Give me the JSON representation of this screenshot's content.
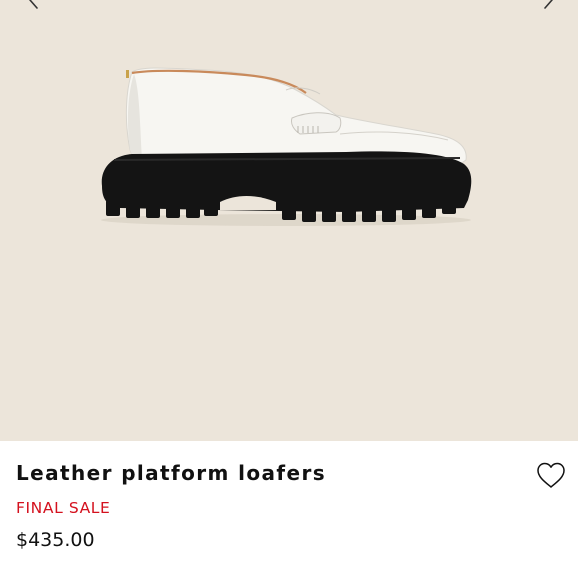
{
  "gallery": {
    "background": "#ece5da",
    "prev_icon": "chevron-left-icon",
    "next_icon": "chevron-right-icon",
    "image_subject": "white leather platform loafer"
  },
  "product": {
    "name": "Leather platform loafers",
    "badge": "FINAL SALE",
    "price": "$435.00",
    "wishlist_icon": "heart-outline-icon"
  },
  "colors": {
    "sale_red": "#d4111e",
    "text": "#111111"
  }
}
